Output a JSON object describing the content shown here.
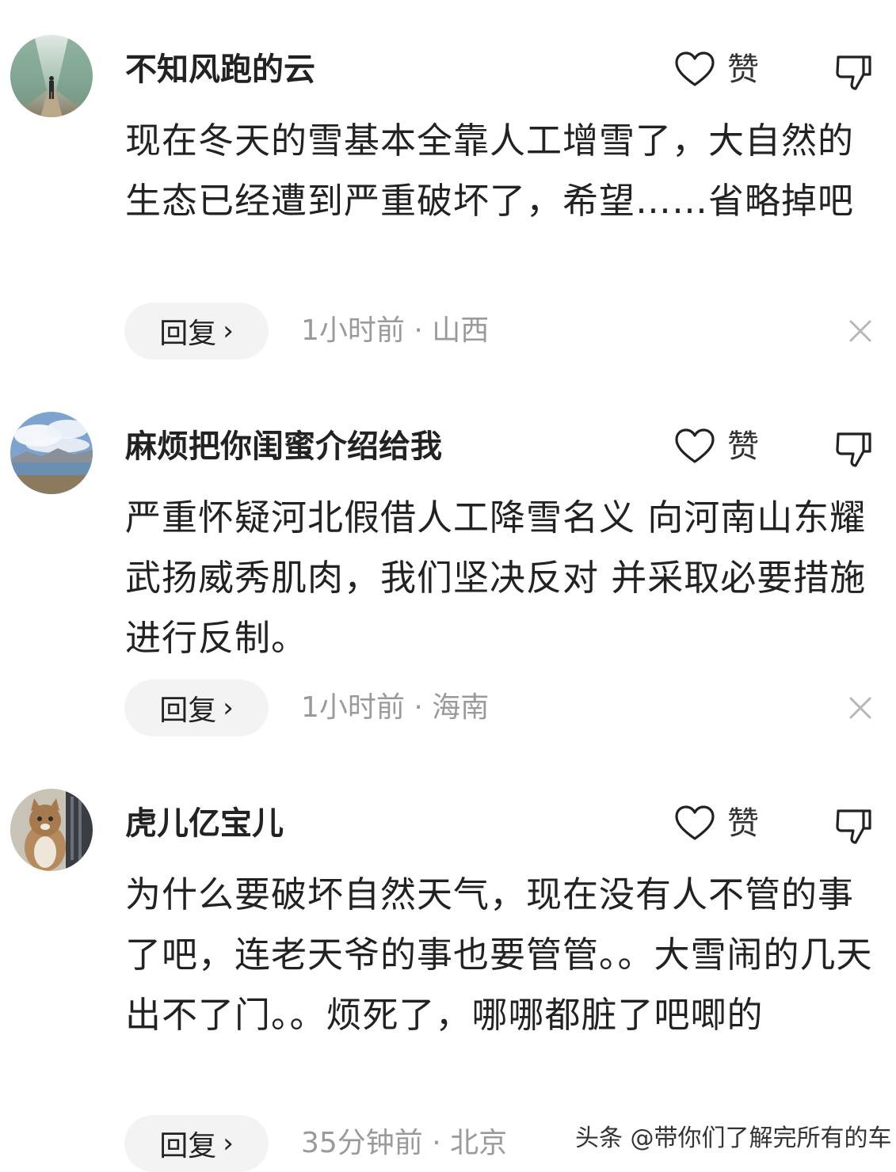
{
  "comments": [
    {
      "username": "不知风跑的云",
      "like_label": "赞",
      "content": "现在冬天的雪基本全靠人工增雪了，大自然的生态已经遭到严重破坏了，希望……省略掉吧",
      "reply_label": "回复",
      "meta": "1小时前 · 山西",
      "avatar_icon": "avatar-person-walking",
      "like_icon": "heart-icon",
      "dislike_icon": "thumbs-down-icon",
      "close_icon": "close-icon"
    },
    {
      "username": "麻烦把你闺蜜介绍给我",
      "like_label": "赞",
      "content": "严重怀疑河北假借人工降雪名义 向河南山东耀武扬威秀肌肉，我们坚决反对 并采取必要措施进行反制。",
      "reply_label": "回复",
      "meta": "1小时前 · 海南",
      "avatar_icon": "avatar-landscape",
      "like_icon": "heart-icon",
      "dislike_icon": "thumbs-down-icon",
      "close_icon": "close-icon"
    },
    {
      "username": "虎儿亿宝儿",
      "like_label": "赞",
      "content": "为什么要破坏自然天气，现在没有人不管的事了吧，连老天爷的事也要管管。。大雪闹的几天出不了门。。烦死了，哪哪都脏了吧唧的",
      "reply_label": "回复",
      "meta": "35分钟前 · 北京",
      "avatar_icon": "avatar-cat",
      "like_icon": "heart-icon",
      "dislike_icon": "thumbs-down-icon"
    }
  ],
  "watermark": "头条 @带你们了解完所有的车",
  "colors": {
    "text": "#222222",
    "meta": "#9a9a9a",
    "reply_bg": "#f3f3f3"
  }
}
